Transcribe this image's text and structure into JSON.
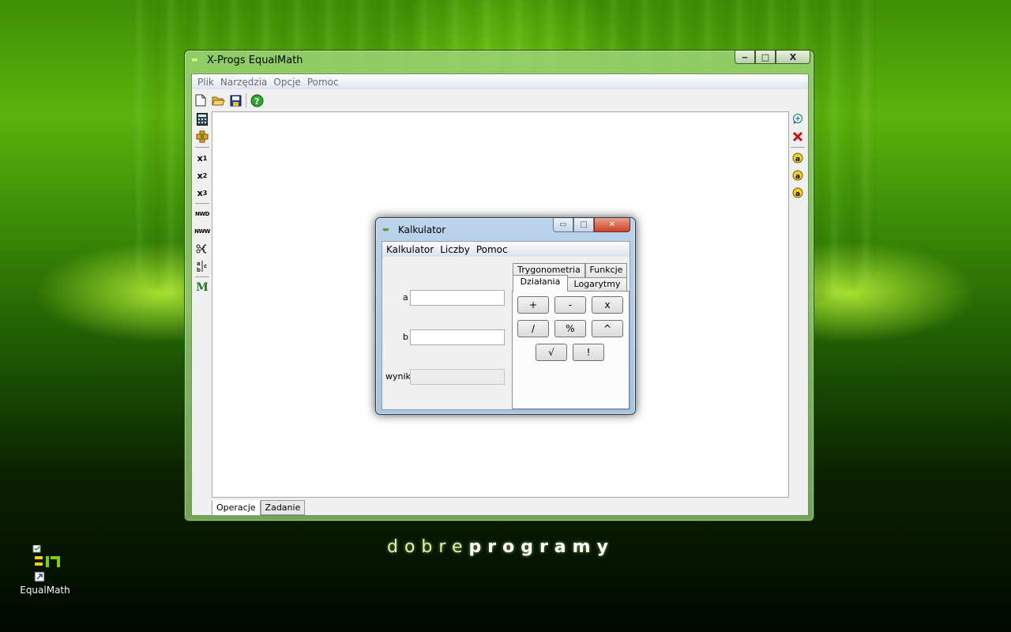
{
  "desktop": {
    "brand_light": "dobre",
    "brand_bold": "programy",
    "shortcut_label": "EqualMath"
  },
  "main_window": {
    "title": "X-Progs EqualMath",
    "controls": {
      "minimize": "‒",
      "maximize": "□",
      "close": "X"
    },
    "menu": [
      "Plik",
      "Narzędzia",
      "Opcje",
      "Pomoc"
    ],
    "toolbar": [
      "new-file-icon",
      "open-folder-icon",
      "save-icon",
      "help-icon"
    ],
    "left_tools": {
      "x1": "x",
      "x1_sup": "1",
      "x2": "x",
      "x2_sup": "2",
      "x3": "x",
      "x3_sup": "3",
      "nwd": "NWD",
      "nww": "NWW",
      "m": "M"
    },
    "bottom_tabs": [
      "Operacje",
      "Zadanie"
    ],
    "active_bottom_tab": "Operacje"
  },
  "calculator": {
    "title": "Kalkulator",
    "menu": [
      "Kalkulator",
      "Liczby",
      "Pomoc"
    ],
    "fields": {
      "a_label": "a",
      "a_value": "",
      "b_label": "b",
      "b_value": "",
      "result_label": "wynik",
      "result_value": ""
    },
    "tabs": {
      "trig": "Trygonometria",
      "func": "Funkcje",
      "ops": "Działania",
      "log": "Logarytmy"
    },
    "active_tab": "Działania",
    "operations": [
      "+",
      "-",
      "x",
      "/",
      "%",
      "^",
      "√",
      "!"
    ]
  },
  "colors": {
    "accent_green": "#5cb30c",
    "calc_close_red": "#c9442a"
  }
}
